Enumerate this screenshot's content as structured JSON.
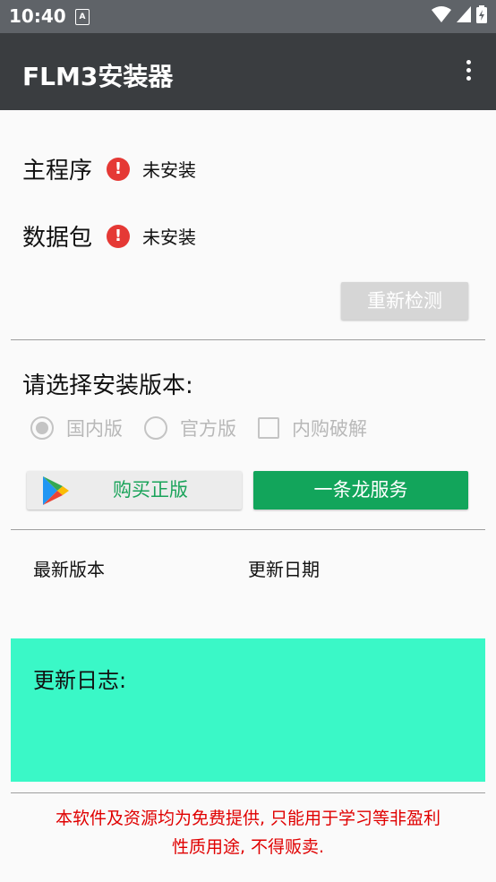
{
  "status_bar": {
    "time": "10:40",
    "notification_icon": "A"
  },
  "app_bar": {
    "title": "FLM3安装器",
    "menu_icon": "more-vert"
  },
  "install_status": [
    {
      "label": "主程序",
      "state": "未安装",
      "icon": "error-icon"
    },
    {
      "label": "数据包",
      "state": "未安装",
      "icon": "error-icon"
    }
  ],
  "recheck_button": "重新检测",
  "version_select": {
    "title": "请选择安装版本:",
    "options": [
      {
        "label": "国内版",
        "type": "radio",
        "selected": true
      },
      {
        "label": "官方版",
        "type": "radio",
        "selected": false
      },
      {
        "label": "内购破解",
        "type": "checkbox",
        "selected": false
      }
    ]
  },
  "buy_button": "购买正版",
  "service_button": "一条龙服务",
  "version_info": {
    "latest_version_label": "最新版本",
    "update_date_label": "更新日期"
  },
  "changelog": {
    "label": "更新日志:"
  },
  "disclaimer": {
    "line1": "本软件及资源均为免费提供, 只能用于学习等非盈利",
    "line2": "性质用途, 不得贩卖."
  },
  "colors": {
    "error": "#e53935",
    "service_green": "#12a55b",
    "changelog_bg": "#3af8c7",
    "disclaimer_red": "#e00000"
  }
}
